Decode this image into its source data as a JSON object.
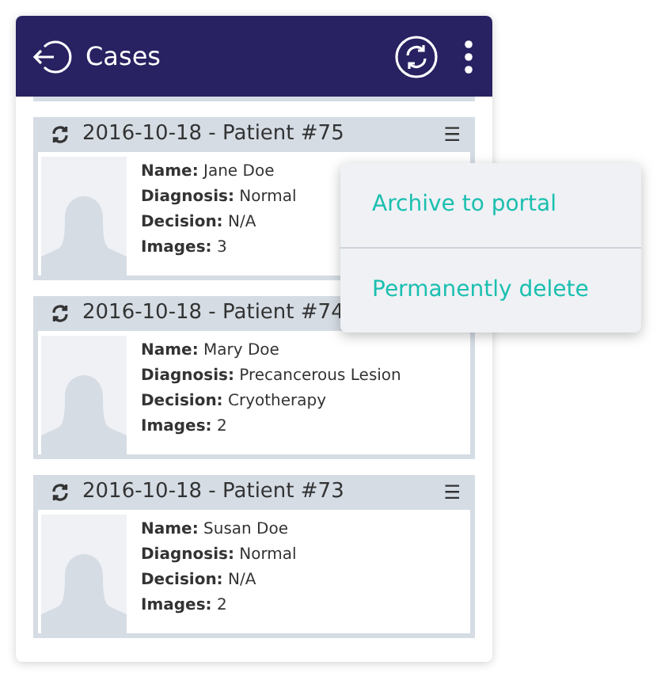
{
  "app_bar": {
    "title": "Cases"
  },
  "cases": [
    {
      "title": "2016-10-18 - Patient #75",
      "menu": "☰",
      "fields": [
        {
          "label": "Name:",
          "value": "Jane Doe"
        },
        {
          "label": "Diagnosis:",
          "value": "Normal"
        },
        {
          "label": "Decision:",
          "value": "N/A"
        },
        {
          "label": "Images:",
          "value": "3"
        }
      ]
    },
    {
      "title": "2016-10-18 - Patient #74",
      "fields": [
        {
          "label": "Name:",
          "value": "Mary Doe"
        },
        {
          "label": "Diagnosis:",
          "value": "Precancerous Lesion"
        },
        {
          "label": "Decision:",
          "value": "Cryotherapy"
        },
        {
          "label": "Images:",
          "value": "2"
        }
      ]
    },
    {
      "title": "2016-10-18 - Patient #73",
      "menu": "☰",
      "fields": [
        {
          "label": "Name:",
          "value": "Susan Doe"
        },
        {
          "label": "Diagnosis:",
          "value": "Normal"
        },
        {
          "label": "Decision:",
          "value": "N/A"
        },
        {
          "label": "Images:",
          "value": "2"
        }
      ]
    }
  ],
  "context_menu": [
    "Archive to portal",
    "Permanently delete"
  ]
}
